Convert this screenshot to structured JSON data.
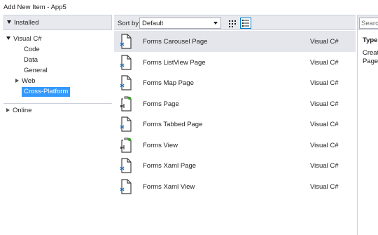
{
  "window": {
    "title": "Add New Item - App5"
  },
  "left_panel": {
    "installed_label": "Installed",
    "tree": [
      {
        "label": "Visual C#",
        "level": 0,
        "expanded": true
      },
      {
        "label": "Code",
        "level": 1
      },
      {
        "label": "Data",
        "level": 1
      },
      {
        "label": "General",
        "level": 1
      },
      {
        "label": "Web",
        "level": 1,
        "collapsed": true
      },
      {
        "label": "Cross-Platform",
        "level": 1,
        "selected": true
      }
    ],
    "online_label": "Online"
  },
  "toolbar": {
    "sort_label": "Sort by:",
    "sort_value": "Default",
    "grid_view_icon": "grid-view-icon",
    "list_view_icon": "list-view-icon"
  },
  "items": [
    {
      "name": "Forms Carousel Page",
      "lang": "Visual C#",
      "icon": "xaml-page-icon",
      "selected": true
    },
    {
      "name": "Forms ListView Page",
      "lang": "Visual C#",
      "icon": "xaml-page-icon"
    },
    {
      "name": "Forms Map Page",
      "lang": "Visual C#",
      "icon": "xaml-page-icon"
    },
    {
      "name": "Forms Page",
      "lang": "Visual C#",
      "icon": "csharp-page-icon"
    },
    {
      "name": "Forms Tabbed Page",
      "lang": "Visual C#",
      "icon": "xaml-page-icon"
    },
    {
      "name": "Forms View",
      "lang": "Visual C#",
      "icon": "csharp-page-icon"
    },
    {
      "name": "Forms Xaml Page",
      "lang": "Visual C#",
      "icon": "xaml-page-icon"
    },
    {
      "name": "Forms Xaml View",
      "lang": "Visual C#",
      "icon": "xaml-page-icon"
    }
  ],
  "right_panel": {
    "search_placeholder": "Search",
    "type_label": "Type",
    "description_line1": "Creat",
    "description_line2": "Page"
  },
  "colors": {
    "accent": "#007acc",
    "selection": "#3399ff",
    "panel_header": "#e8e9ef",
    "icon_blue": "#1e73c8",
    "icon_green": "#3fa12f"
  }
}
